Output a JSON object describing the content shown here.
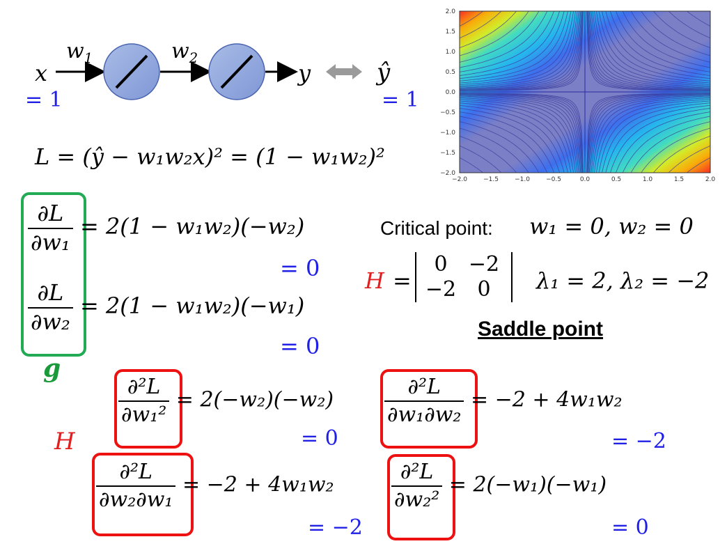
{
  "network": {
    "x": "x",
    "w1": "w",
    "w1_sub": "1",
    "w2": "w",
    "w2_sub": "2",
    "y": "y",
    "yhat": "ŷ",
    "x_val": "= 1",
    "yhat_val": "= 1"
  },
  "loss": {
    "text": "L = (ŷ − w₁w₂x)² = (1 − w₁w₂)²"
  },
  "gradient": {
    "d1_num": "∂L",
    "d1_den": "∂w₁",
    "d1_rhs": "= 2(1 − w₁w₂)(−w₂)",
    "d1_val": "= 0",
    "d2_num": "∂L",
    "d2_den": "∂w₂",
    "d2_rhs": "= 2(1 − w₁w₂)(−w₁)",
    "d2_val": "= 0",
    "label": "g"
  },
  "critical": {
    "label": "Critical point:",
    "value": "w₁ = 0, w₂ = 0",
    "H": "H",
    "matrix": [
      "0",
      "−2",
      "−2",
      "0"
    ],
    "eigen": "λ₁ = 2, λ₂ = −2",
    "saddle": "Saddle point"
  },
  "hessian": {
    "label": "H",
    "h11_num": "∂²L",
    "h11_den": "∂w₁²",
    "h11_rhs": "= 2(−w₂)(−w₂)",
    "h11_val": "= 0",
    "h12_num": "∂²L",
    "h12_den": "∂w₁∂w₂",
    "h12_rhs": "= −2 + 4w₁w₂",
    "h12_val": "= −2",
    "h21_num": "∂²L",
    "h21_den": "∂w₂∂w₁",
    "h21_rhs": "= −2 + 4w₁w₂",
    "h21_val": "= −2",
    "h22_num": "∂²L",
    "h22_den": "∂w₂²",
    "h22_rhs": "= 2(−w₁)(−w₁)",
    "h22_val": "= 0"
  },
  "plot": {
    "xticks": [
      "−2.0",
      "−1.5",
      "−1.0",
      "−0.5",
      "0.0",
      "0.5",
      "1.0",
      "1.5",
      "2.0"
    ],
    "yticks": [
      "2.0",
      "1.5",
      "1.0",
      "0.5",
      "0.0",
      "−0.5",
      "−1.0",
      "−1.5",
      "−2.0"
    ]
  },
  "colors": {
    "blue": "#1f1fe6",
    "red": "#e02020",
    "green": "#1a9a3a",
    "plot_center": "#7b7fc6"
  }
}
